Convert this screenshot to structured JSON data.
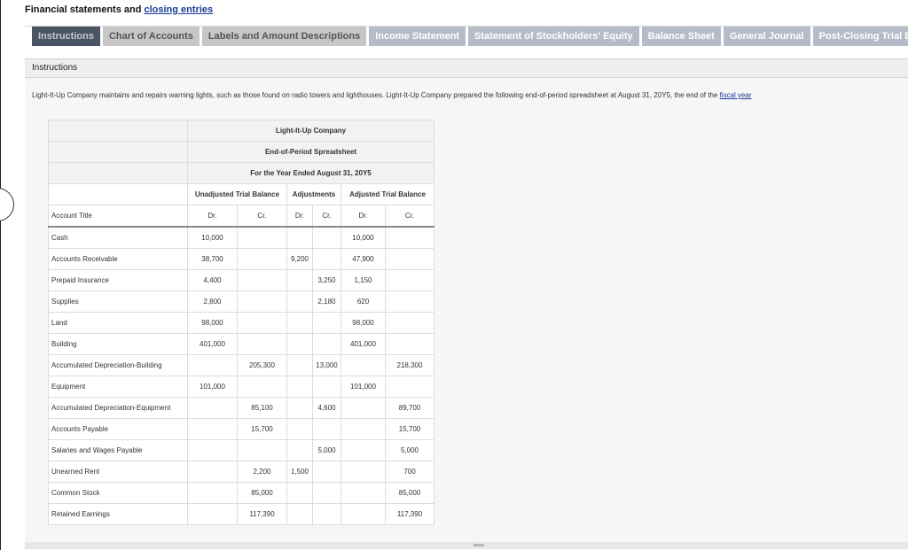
{
  "page": {
    "title_prefix": "Financial statements and ",
    "title_link": "closing entries"
  },
  "tabs": [
    {
      "label": "Instructions"
    },
    {
      "label": "Chart of Accounts"
    },
    {
      "label": "Labels and Amount Descriptions"
    },
    {
      "label": "Income Statement"
    },
    {
      "label": "Statement of Stockholders' Equity"
    },
    {
      "label": "Balance Sheet"
    },
    {
      "label": "General Journal"
    },
    {
      "label": "Post-Closing Trial Balance"
    }
  ],
  "section": {
    "heading": "Instructions",
    "intro_text": "Light-It-Up Company maintains and repairs warning lights, such as those found on radio towers and lighthouses. Light-It-Up Company prepared the following end-of-period spreadsheet at August 31, 20Y5, the end of the ",
    "intro_link": "fiscal year"
  },
  "spreadsheet": {
    "company": "Light-It-Up Company",
    "name": "End-of-Period Spreadsheet",
    "period": "For the Year Ended August 31, 20Y5",
    "group_headers": [
      "Unadjusted Trial Balance",
      "Adjustments",
      "Adjusted Trial Balance"
    ],
    "account_title_label": "Account Title",
    "col_labels": [
      "Dr.",
      "Cr.",
      "Dr.",
      "Cr.",
      "Dr.",
      "Cr."
    ],
    "rows": [
      {
        "account": "Cash",
        "utb_dr": "10,000",
        "utb_cr": "",
        "adj_dr": "",
        "adj_cr": "",
        "atb_dr": "10,000",
        "atb_cr": ""
      },
      {
        "account": "Accounts Receivable",
        "utb_dr": "38,700",
        "utb_cr": "",
        "adj_dr": "9,200",
        "adj_cr": "",
        "atb_dr": "47,900",
        "atb_cr": ""
      },
      {
        "account": "Prepaid Insurance",
        "utb_dr": "4,400",
        "utb_cr": "",
        "adj_dr": "",
        "adj_cr": "3,250",
        "atb_dr": "1,150",
        "atb_cr": ""
      },
      {
        "account": "Supplies",
        "utb_dr": "2,800",
        "utb_cr": "",
        "adj_dr": "",
        "adj_cr": "2,180",
        "atb_dr": "620",
        "atb_cr": ""
      },
      {
        "account": "Land",
        "utb_dr": "98,000",
        "utb_cr": "",
        "adj_dr": "",
        "adj_cr": "",
        "atb_dr": "98,000",
        "atb_cr": ""
      },
      {
        "account": "Building",
        "utb_dr": "401,000",
        "utb_cr": "",
        "adj_dr": "",
        "adj_cr": "",
        "atb_dr": "401,000",
        "atb_cr": ""
      },
      {
        "account": "Accumulated Depreciation-Building",
        "utb_dr": "",
        "utb_cr": "205,300",
        "adj_dr": "",
        "adj_cr": "13,000",
        "atb_dr": "",
        "atb_cr": "218,300"
      },
      {
        "account": "Equipment",
        "utb_dr": "101,000",
        "utb_cr": "",
        "adj_dr": "",
        "adj_cr": "",
        "atb_dr": "101,000",
        "atb_cr": ""
      },
      {
        "account": "Accumulated Depreciation-Equipment",
        "utb_dr": "",
        "utb_cr": "85,100",
        "adj_dr": "",
        "adj_cr": "4,600",
        "atb_dr": "",
        "atb_cr": "89,700"
      },
      {
        "account": "Accounts Payable",
        "utb_dr": "",
        "utb_cr": "15,700",
        "adj_dr": "",
        "adj_cr": "",
        "atb_dr": "",
        "atb_cr": "15,700"
      },
      {
        "account": "Salaries and Wages Payable",
        "utb_dr": "",
        "utb_cr": "",
        "adj_dr": "",
        "adj_cr": "5,000",
        "atb_dr": "",
        "atb_cr": "5,000"
      },
      {
        "account": "Unearned Rent",
        "utb_dr": "",
        "utb_cr": "2,200",
        "adj_dr": "1,500",
        "adj_cr": "",
        "atb_dr": "",
        "atb_cr": "700"
      },
      {
        "account": "Common Stock",
        "utb_dr": "",
        "utb_cr": "85,000",
        "adj_dr": "",
        "adj_cr": "",
        "atb_dr": "",
        "atb_cr": "85,000"
      },
      {
        "account": "Retained Earnings",
        "utb_dr": "",
        "utb_cr": "117,390",
        "adj_dr": "",
        "adj_cr": "",
        "atb_dr": "",
        "atb_cr": "117,390"
      }
    ]
  }
}
